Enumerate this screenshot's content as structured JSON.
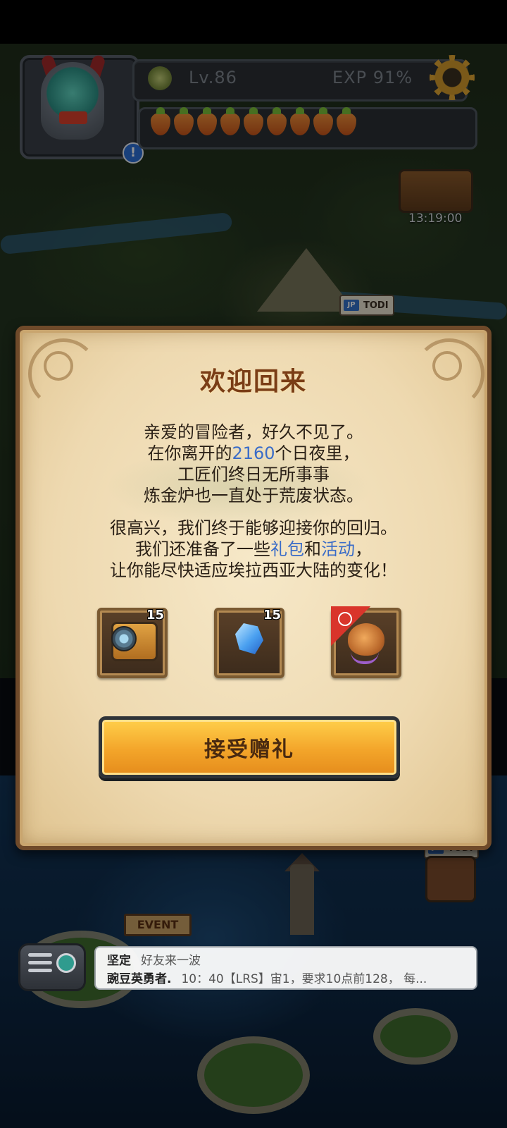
{
  "hud": {
    "level": "Lv.86",
    "exp": "EXP 91%",
    "energy_count": 9,
    "chest_timer": "13:19:00",
    "todi_tag": "TODI",
    "todi_flag": "JP",
    "event_sign": "EVENT"
  },
  "dialog": {
    "title": "欢迎回来",
    "para1": [
      {
        "text": "亲爱的冒险者，好久不见了。"
      },
      {
        "text": "在你离开的",
        "days": "2160",
        "after": "个日夜里，"
      },
      {
        "text": "工匠们终日无所事事"
      },
      {
        "text": "炼金炉也一直处于荒废状态。"
      }
    ],
    "para2": [
      {
        "text": "很高兴，我们终于能够迎接你的回归。"
      },
      {
        "text": "我们还准备了一些",
        "link1": "礼包",
        "mid": "和",
        "link2": "活动",
        "after": "，"
      },
      {
        "text": "让你能尽快适应埃拉西亚大陆的变化！"
      }
    ],
    "rewards": [
      {
        "name": "camera-item",
        "count": "15"
      },
      {
        "name": "crystal-item",
        "count": "15"
      },
      {
        "name": "creature-item",
        "count": ""
      }
    ],
    "accept_label": "接受赠礼"
  },
  "chat": {
    "line1_name": "坚定",
    "line1_msg": "好友来一波",
    "line2_name": "豌豆英勇者.",
    "line2_msg": "10：40【LRS】宙1，要求10点前128， 每..."
  },
  "colors": {
    "title": "#7a3d16",
    "highlight": "#3a6cc8",
    "button": "#f3a52a"
  }
}
